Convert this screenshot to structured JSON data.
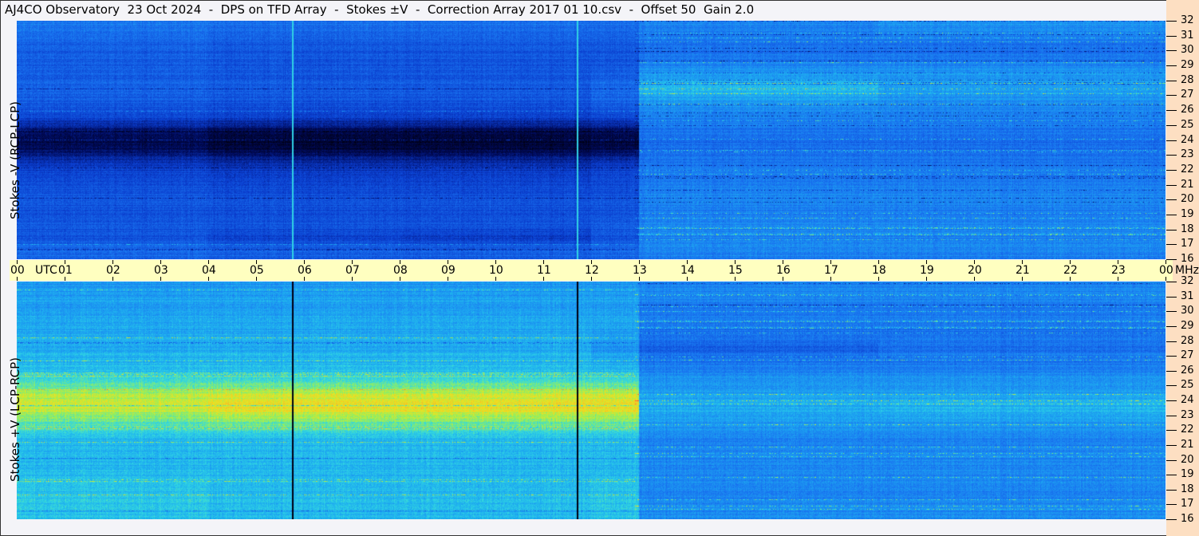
{
  "title": "AJ4CO Observatory  23 Oct 2024  -  DPS on TFD Array  -  Stokes ±V  -  Correction Array 2017 01 10.csv  -  Offset 50  Gain 2.0",
  "colors": {
    "background": "#f4f4f8",
    "time_axis_band": "#ffffc0",
    "freq_axis_strip": "#fddfc2"
  },
  "chart_data": [
    {
      "type": "heatmap",
      "panel": "top",
      "ylabel": "Stokes -V (RCP-LCP)",
      "xlabel_unit": "UTC",
      "ylabel_unit": "MHz",
      "x_range": [
        0,
        24
      ],
      "y_range": [
        16,
        32
      ],
      "x_ticks": [
        "00",
        "01",
        "02",
        "03",
        "04",
        "05",
        "06",
        "07",
        "08",
        "09",
        "10",
        "11",
        "12",
        "13",
        "14",
        "15",
        "16",
        "17",
        "18",
        "19",
        "20",
        "21",
        "22",
        "23",
        "00"
      ],
      "y_ticks": [
        32,
        31,
        30,
        29,
        28,
        27,
        26,
        25,
        24,
        23,
        22,
        21,
        20,
        19,
        18,
        17,
        16
      ],
      "colormap": "jet",
      "x_bin_edges_utc": [
        0,
        4,
        8,
        12,
        13,
        18,
        24
      ],
      "y_bin_edges_mhz": [
        32,
        31,
        30,
        29,
        28,
        27,
        26,
        25,
        24,
        23,
        22,
        21,
        20,
        19,
        18,
        17,
        16
      ],
      "relative_intensity": [
        [
          0.42,
          0.4,
          0.4,
          0.4,
          0.45,
          0.48
        ],
        [
          0.38,
          0.36,
          0.36,
          0.36,
          0.42,
          0.42
        ],
        [
          0.36,
          0.34,
          0.34,
          0.34,
          0.42,
          0.42
        ],
        [
          0.36,
          0.34,
          0.34,
          0.36,
          0.5,
          0.5
        ],
        [
          0.38,
          0.36,
          0.36,
          0.4,
          0.58,
          0.52
        ],
        [
          0.36,
          0.34,
          0.34,
          0.38,
          0.5,
          0.48
        ],
        [
          0.3,
          0.28,
          0.28,
          0.3,
          0.45,
          0.45
        ],
        [
          0.12,
          0.08,
          0.08,
          0.1,
          0.42,
          0.42
        ],
        [
          0.1,
          0.06,
          0.06,
          0.08,
          0.4,
          0.4
        ],
        [
          0.25,
          0.22,
          0.22,
          0.25,
          0.42,
          0.42
        ],
        [
          0.32,
          0.3,
          0.3,
          0.32,
          0.44,
          0.44
        ],
        [
          0.34,
          0.32,
          0.32,
          0.33,
          0.46,
          0.46
        ],
        [
          0.34,
          0.33,
          0.33,
          0.34,
          0.45,
          0.45
        ],
        [
          0.35,
          0.34,
          0.34,
          0.36,
          0.46,
          0.46
        ],
        [
          0.34,
          0.3,
          0.28,
          0.34,
          0.46,
          0.46
        ],
        [
          0.4,
          0.38,
          0.38,
          0.4,
          0.46,
          0.46
        ]
      ],
      "vertical_lines_utc": [
        5.75,
        11.7
      ],
      "vertical_line_intensity": 0.62
    },
    {
      "type": "heatmap",
      "panel": "bottom",
      "ylabel": "Stokes +V (LCP-RCP)",
      "x_range": [
        0,
        24
      ],
      "y_range": [
        16,
        32
      ],
      "y_ticks": [
        32,
        31,
        30,
        29,
        28,
        27,
        26,
        25,
        24,
        23,
        22,
        21,
        20,
        19,
        18,
        17,
        16
      ],
      "colormap": "jet",
      "x_bin_edges_utc": [
        0,
        4,
        8,
        12,
        13,
        18,
        24
      ],
      "y_bin_edges_mhz": [
        32,
        31,
        30,
        29,
        28,
        27,
        26,
        25,
        24,
        23,
        22,
        21,
        20,
        19,
        18,
        17,
        16
      ],
      "relative_intensity": [
        [
          0.5,
          0.5,
          0.5,
          0.5,
          0.46,
          0.46
        ],
        [
          0.52,
          0.52,
          0.52,
          0.52,
          0.44,
          0.44
        ],
        [
          0.53,
          0.53,
          0.53,
          0.53,
          0.44,
          0.44
        ],
        [
          0.54,
          0.54,
          0.54,
          0.52,
          0.42,
          0.42
        ],
        [
          0.55,
          0.55,
          0.55,
          0.5,
          0.38,
          0.42
        ],
        [
          0.57,
          0.57,
          0.57,
          0.55,
          0.44,
          0.44
        ],
        [
          0.62,
          0.62,
          0.62,
          0.62,
          0.48,
          0.48
        ],
        [
          0.74,
          0.76,
          0.76,
          0.76,
          0.52,
          0.52
        ],
        [
          0.76,
          0.8,
          0.8,
          0.8,
          0.54,
          0.56
        ],
        [
          0.66,
          0.68,
          0.68,
          0.68,
          0.5,
          0.5
        ],
        [
          0.58,
          0.58,
          0.58,
          0.58,
          0.46,
          0.46
        ],
        [
          0.56,
          0.56,
          0.56,
          0.56,
          0.46,
          0.46
        ],
        [
          0.56,
          0.56,
          0.56,
          0.56,
          0.46,
          0.46
        ],
        [
          0.58,
          0.56,
          0.56,
          0.58,
          0.46,
          0.46
        ],
        [
          0.6,
          0.58,
          0.58,
          0.6,
          0.46,
          0.46
        ],
        [
          0.58,
          0.56,
          0.56,
          0.58,
          0.47,
          0.47
        ]
      ],
      "vertical_lines_utc": [
        5.75,
        11.7
      ],
      "vertical_line_intensity": 0.0
    }
  ],
  "time_axis": {
    "utc_label": "UTC",
    "mhz_label": "MHz"
  }
}
